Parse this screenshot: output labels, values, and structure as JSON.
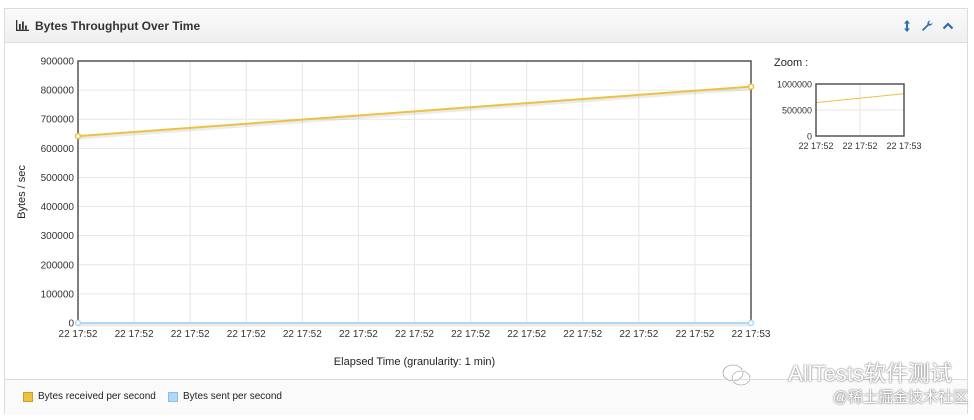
{
  "panel": {
    "title": "Bytes Throughput Over Time"
  },
  "header_icons": [
    "bar-chart-icon",
    "expand-icon",
    "wrench-icon",
    "collapse-icon"
  ],
  "chart_data": {
    "type": "line",
    "title": "",
    "ylabel": "Bytes / sec",
    "xlabel": "Elapsed Time (granularity: 1 min)",
    "ylim": [
      0,
      900000
    ],
    "yticks": [
      "900000",
      "800000",
      "700000",
      "600000",
      "500000",
      "400000",
      "300000",
      "200000",
      "100000",
      "0"
    ],
    "xticks": [
      "22 17:52",
      "22 17:52",
      "22 17:52",
      "22 17:52",
      "22 17:52",
      "22 17:52",
      "22 17:52",
      "22 17:52",
      "22 17:52",
      "22 17:52",
      "22 17:52",
      "22 17:52",
      "22 17:53"
    ],
    "series": [
      {
        "name": "Bytes received per second",
        "color": "#edc240",
        "values": [
          642000,
          812000
        ]
      },
      {
        "name": "Bytes sent per second",
        "color": "#afd8f8",
        "values": [
          0,
          0
        ]
      }
    ],
    "grid": true,
    "legend_position": "bottom"
  },
  "zoom": {
    "label": "Zoom :",
    "yticks": [
      "1000000",
      "500000",
      "0"
    ],
    "xticks": [
      "22 17:52",
      "22 17:52",
      "22 17:53"
    ],
    "ylim": [
      0,
      1000000
    ]
  },
  "legend": {
    "items": [
      {
        "label": "Bytes received per second",
        "color": "#edc240"
      },
      {
        "label": "Bytes sent per second",
        "color": "#afd8f8"
      }
    ]
  },
  "watermark": {
    "line1": "AllTests软件测试",
    "line2": "@稀土掘金技术社区"
  }
}
